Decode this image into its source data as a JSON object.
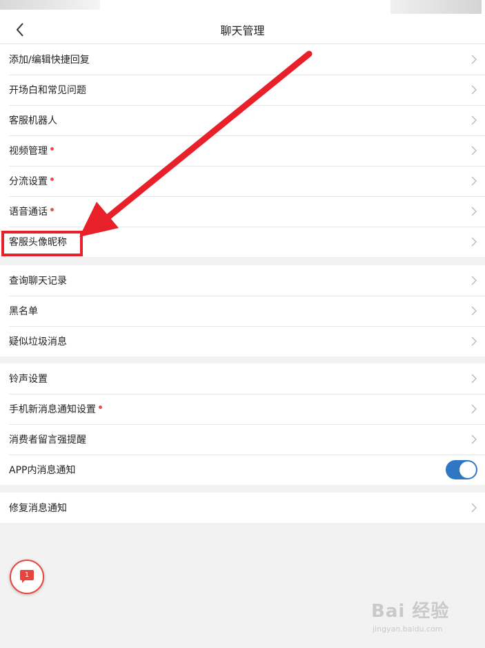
{
  "header": {
    "title": "聊天管理"
  },
  "groups": [
    {
      "items": [
        {
          "label": "添加/编辑快捷回复",
          "dot": false
        },
        {
          "label": "开场白和常见问题",
          "dot": false
        },
        {
          "label": "客服机器人",
          "dot": false
        },
        {
          "label": "视频管理",
          "dot": true
        },
        {
          "label": "分流设置",
          "dot": true
        },
        {
          "label": "语音通话",
          "dot": true
        },
        {
          "label": "客服头像昵称",
          "dot": false,
          "highlighted": true
        }
      ]
    },
    {
      "items": [
        {
          "label": "查询聊天记录",
          "dot": false
        },
        {
          "label": "黑名单",
          "dot": false
        },
        {
          "label": "疑似垃圾消息",
          "dot": false
        }
      ]
    },
    {
      "items": [
        {
          "label": "铃声设置",
          "dot": false
        },
        {
          "label": "手机新消息通知设置",
          "dot": true
        },
        {
          "label": "消费者留言强提醒",
          "dot": false
        },
        {
          "label": "APP内消息通知",
          "dot": false,
          "toggle": true,
          "toggle_on": true
        }
      ]
    },
    {
      "items": [
        {
          "label": "修复消息通知",
          "dot": false
        }
      ]
    }
  ],
  "fab": {
    "badge_count": "1"
  },
  "watermark": {
    "main": "Bai 经验",
    "sub": "jingyan.baidu.com"
  },
  "colors": {
    "accent_red": "#e8202a",
    "toggle_blue": "#2f77c3",
    "dot_red": "#ef4b4b"
  },
  "icons": {
    "back": "chevron-left-icon",
    "row": "chevron-right-icon",
    "fab": "chat-bubble-icon"
  }
}
